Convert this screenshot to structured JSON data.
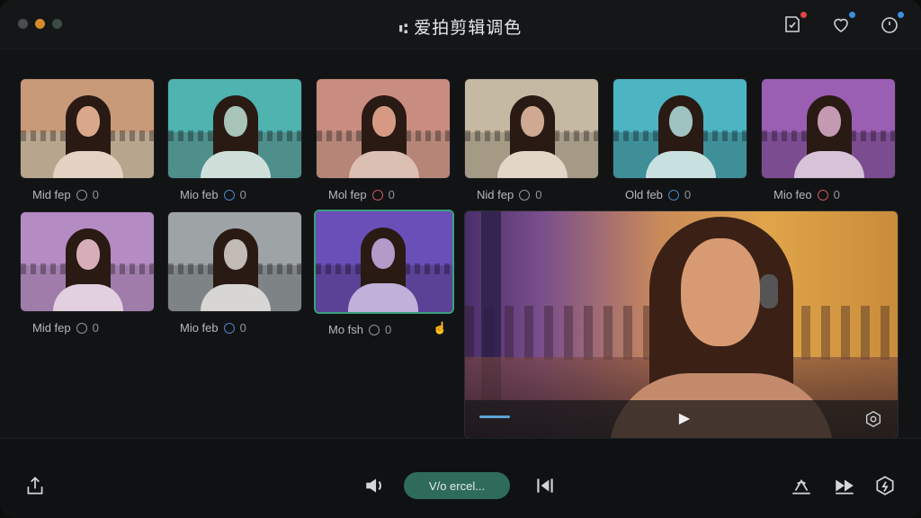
{
  "window": {
    "traffic_lights": [
      {
        "name": "close",
        "color": "#4a4d4f"
      },
      {
        "name": "minimize",
        "color": "#d98b2b"
      },
      {
        "name": "zoom",
        "color": "#3e4a44"
      }
    ],
    "title_glyph": "A",
    "title": "爱拍剪辑调色",
    "top_icons": [
      {
        "name": "edit-check-icon",
        "badge_color": "#e04545"
      },
      {
        "name": "heart-icon",
        "badge_color": "#3b8fe0"
      },
      {
        "name": "timer-icon",
        "badge_color": "#3b8fe0"
      }
    ]
  },
  "grid": {
    "items": [
      {
        "label": "Mid fep",
        "count": "0",
        "tint": "#c89a7a",
        "ground": "#b8a58e",
        "face": "#d9a88a",
        "body": "#e6d2c4",
        "icon": "#8f979b"
      },
      {
        "label": "Mio feb",
        "count": "0",
        "tint": "#4fb3b0",
        "ground": "#4e8f8c",
        "face": "#a9c4b9",
        "body": "#cfe0da",
        "icon": "#4a86c7"
      },
      {
        "label": "Mol fep",
        "count": "0",
        "tint": "#c98d80",
        "ground": "#b58578",
        "face": "#d69a84",
        "body": "#dcbfb3",
        "icon": "#c45a5a"
      },
      {
        "label": "Nid fep",
        "count": "0",
        "tint": "#c6b9a4",
        "ground": "#a59a86",
        "face": "#cfa992",
        "body": "#e3d6c7",
        "icon": "#8f979b"
      },
      {
        "label": "Old feb",
        "count": "0",
        "tint": "#4db4c2",
        "ground": "#3f8f99",
        "face": "#9fc3c0",
        "body": "#c9e0e0",
        "icon": "#4a86c7"
      },
      {
        "label": "Mio feo",
        "count": "0",
        "tint": "#9a5fb3",
        "ground": "#7c4c91",
        "face": "#c49ab2",
        "body": "#d7c2d8",
        "icon": "#c45a5a"
      },
      {
        "label": "Mid fep",
        "count": "0",
        "tint": "#b48bc2",
        "ground": "#a07cab",
        "face": "#d6aeb8",
        "body": "#e2cfe0",
        "icon": "#8f979b"
      },
      {
        "label": "Mio feb",
        "count": "0",
        "tint": "#9ea3a6",
        "ground": "#7e8386",
        "face": "#c1bab5",
        "body": "#d8d6d4",
        "icon": "#4a86c7"
      },
      {
        "label": "Mo fsh",
        "count": "0",
        "tint": "#6a4fb8",
        "ground": "#5b4296",
        "face": "#b49ac9",
        "body": "#bfb1d9",
        "icon": "#8f979b"
      },
      {
        "label": "",
        "count": "",
        "tint": "#c2c28a",
        "ground": "#a4a473",
        "face": "#d3b593",
        "body": "#e1dcc2",
        "icon": "#8f979b"
      },
      {
        "label": "",
        "count": "",
        "tint": "#d88aa8",
        "ground": "#b47a9a",
        "face": "#e1a7a1",
        "body": "#e5c7cf",
        "icon": "#8f979b"
      },
      {
        "label": "",
        "count": "",
        "tint": "#6fb6a8",
        "ground": "#c98b5c",
        "face": "#c99b7c",
        "body": "#b9c79a",
        "icon": "#8f979b"
      }
    ]
  },
  "preview": {
    "play_icon": "▶"
  },
  "bottom": {
    "primary_label": "V/o ercel...",
    "left_icons": [
      "share-icon"
    ],
    "center_icons": [
      "speaker-icon",
      "skip-end-icon"
    ],
    "right_icons": [
      "cast-icon",
      "fast-forward-icon",
      "settings-hex-icon"
    ]
  }
}
